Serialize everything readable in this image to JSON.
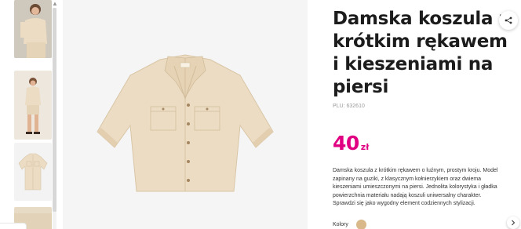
{
  "product": {
    "title": "Damska koszula z krótkim rękawem i kieszeniami na piersi",
    "plu": "PLU: 632610",
    "price": {
      "amount": "40",
      "currency": "zł"
    },
    "description": "Damska koszula z krótkim rękawem o luźnym, prostym kroju. Model\nzapinany na guziki, z klasycznym kołnierzykiem oraz dwiema\nkieszeniami umieszczonymi na piersi. Jednolita kolorystyka i gładka\npowierzchnia materiału nadają koszuli uniwersalny charakter.\nSprawdzi się jako wygodny element codziennych stylizacji.",
    "colors_label": "Kolory",
    "colors": [
      {
        "name": "beige-swatch",
        "hex": "#d9b98a"
      }
    ]
  },
  "gallery": {
    "thumbnails": [
      {
        "icon": "model-front-thumbnail"
      },
      {
        "icon": "model-full-body-thumbnail"
      },
      {
        "icon": "shirt-flat-thumbnail"
      },
      {
        "icon": "detail-thumbnail"
      }
    ]
  },
  "colors": {
    "price_accent": "#e10082",
    "title": "#1c1c1c",
    "shirt": "#ecdcc3",
    "image_bg": "#f5f5f5"
  },
  "icons": {
    "share": "share-icon",
    "next": "chevron-right-icon"
  }
}
